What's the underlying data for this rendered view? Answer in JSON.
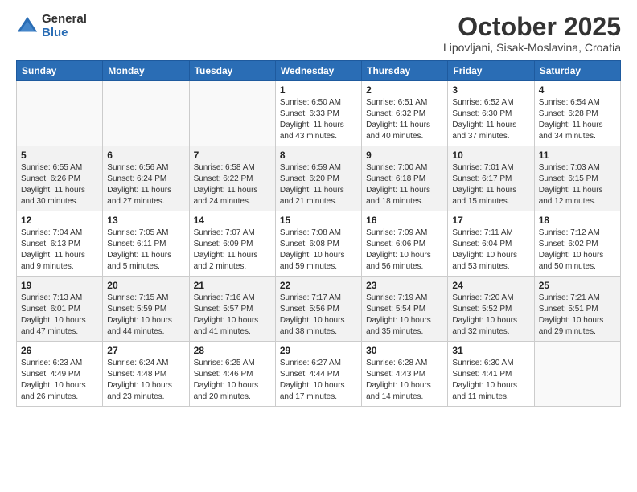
{
  "logo": {
    "general": "General",
    "blue": "Blue"
  },
  "title": {
    "month": "October 2025",
    "location": "Lipovljani, Sisak-Moslavina, Croatia"
  },
  "weekdays": [
    "Sunday",
    "Monday",
    "Tuesday",
    "Wednesday",
    "Thursday",
    "Friday",
    "Saturday"
  ],
  "weeks": [
    [
      {
        "day": "",
        "info": ""
      },
      {
        "day": "",
        "info": ""
      },
      {
        "day": "",
        "info": ""
      },
      {
        "day": "1",
        "info": "Sunrise: 6:50 AM\nSunset: 6:33 PM\nDaylight: 11 hours\nand 43 minutes."
      },
      {
        "day": "2",
        "info": "Sunrise: 6:51 AM\nSunset: 6:32 PM\nDaylight: 11 hours\nand 40 minutes."
      },
      {
        "day": "3",
        "info": "Sunrise: 6:52 AM\nSunset: 6:30 PM\nDaylight: 11 hours\nand 37 minutes."
      },
      {
        "day": "4",
        "info": "Sunrise: 6:54 AM\nSunset: 6:28 PM\nDaylight: 11 hours\nand 34 minutes."
      }
    ],
    [
      {
        "day": "5",
        "info": "Sunrise: 6:55 AM\nSunset: 6:26 PM\nDaylight: 11 hours\nand 30 minutes."
      },
      {
        "day": "6",
        "info": "Sunrise: 6:56 AM\nSunset: 6:24 PM\nDaylight: 11 hours\nand 27 minutes."
      },
      {
        "day": "7",
        "info": "Sunrise: 6:58 AM\nSunset: 6:22 PM\nDaylight: 11 hours\nand 24 minutes."
      },
      {
        "day": "8",
        "info": "Sunrise: 6:59 AM\nSunset: 6:20 PM\nDaylight: 11 hours\nand 21 minutes."
      },
      {
        "day": "9",
        "info": "Sunrise: 7:00 AM\nSunset: 6:18 PM\nDaylight: 11 hours\nand 18 minutes."
      },
      {
        "day": "10",
        "info": "Sunrise: 7:01 AM\nSunset: 6:17 PM\nDaylight: 11 hours\nand 15 minutes."
      },
      {
        "day": "11",
        "info": "Sunrise: 7:03 AM\nSunset: 6:15 PM\nDaylight: 11 hours\nand 12 minutes."
      }
    ],
    [
      {
        "day": "12",
        "info": "Sunrise: 7:04 AM\nSunset: 6:13 PM\nDaylight: 11 hours\nand 9 minutes."
      },
      {
        "day": "13",
        "info": "Sunrise: 7:05 AM\nSunset: 6:11 PM\nDaylight: 11 hours\nand 5 minutes."
      },
      {
        "day": "14",
        "info": "Sunrise: 7:07 AM\nSunset: 6:09 PM\nDaylight: 11 hours\nand 2 minutes."
      },
      {
        "day": "15",
        "info": "Sunrise: 7:08 AM\nSunset: 6:08 PM\nDaylight: 10 hours\nand 59 minutes."
      },
      {
        "day": "16",
        "info": "Sunrise: 7:09 AM\nSunset: 6:06 PM\nDaylight: 10 hours\nand 56 minutes."
      },
      {
        "day": "17",
        "info": "Sunrise: 7:11 AM\nSunset: 6:04 PM\nDaylight: 10 hours\nand 53 minutes."
      },
      {
        "day": "18",
        "info": "Sunrise: 7:12 AM\nSunset: 6:02 PM\nDaylight: 10 hours\nand 50 minutes."
      }
    ],
    [
      {
        "day": "19",
        "info": "Sunrise: 7:13 AM\nSunset: 6:01 PM\nDaylight: 10 hours\nand 47 minutes."
      },
      {
        "day": "20",
        "info": "Sunrise: 7:15 AM\nSunset: 5:59 PM\nDaylight: 10 hours\nand 44 minutes."
      },
      {
        "day": "21",
        "info": "Sunrise: 7:16 AM\nSunset: 5:57 PM\nDaylight: 10 hours\nand 41 minutes."
      },
      {
        "day": "22",
        "info": "Sunrise: 7:17 AM\nSunset: 5:56 PM\nDaylight: 10 hours\nand 38 minutes."
      },
      {
        "day": "23",
        "info": "Sunrise: 7:19 AM\nSunset: 5:54 PM\nDaylight: 10 hours\nand 35 minutes."
      },
      {
        "day": "24",
        "info": "Sunrise: 7:20 AM\nSunset: 5:52 PM\nDaylight: 10 hours\nand 32 minutes."
      },
      {
        "day": "25",
        "info": "Sunrise: 7:21 AM\nSunset: 5:51 PM\nDaylight: 10 hours\nand 29 minutes."
      }
    ],
    [
      {
        "day": "26",
        "info": "Sunrise: 6:23 AM\nSunset: 4:49 PM\nDaylight: 10 hours\nand 26 minutes."
      },
      {
        "day": "27",
        "info": "Sunrise: 6:24 AM\nSunset: 4:48 PM\nDaylight: 10 hours\nand 23 minutes."
      },
      {
        "day": "28",
        "info": "Sunrise: 6:25 AM\nSunset: 4:46 PM\nDaylight: 10 hours\nand 20 minutes."
      },
      {
        "day": "29",
        "info": "Sunrise: 6:27 AM\nSunset: 4:44 PM\nDaylight: 10 hours\nand 17 minutes."
      },
      {
        "day": "30",
        "info": "Sunrise: 6:28 AM\nSunset: 4:43 PM\nDaylight: 10 hours\nand 14 minutes."
      },
      {
        "day": "31",
        "info": "Sunrise: 6:30 AM\nSunset: 4:41 PM\nDaylight: 10 hours\nand 11 minutes."
      },
      {
        "day": "",
        "info": ""
      }
    ]
  ]
}
